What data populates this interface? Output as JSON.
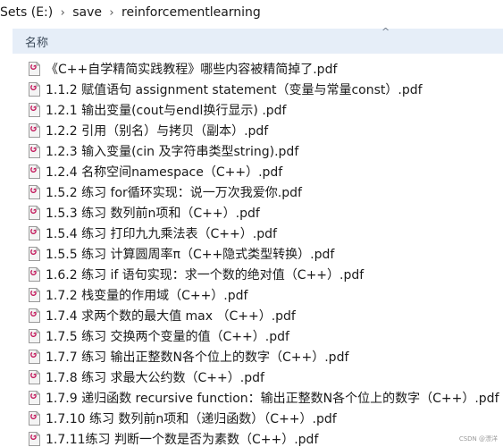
{
  "breadcrumb": {
    "items": [
      "Sets (E:)",
      "save",
      "reinforcementlearning"
    ],
    "separator": "›"
  },
  "header": {
    "name_column": "名称",
    "sort_indicator": "^"
  },
  "files": [
    "《C++自学精简实践教程》哪些内容被精简掉了.pdf",
    "1.1.2 赋值语句 assignment statement（变量与常量const）.pdf",
    "1.2.1 输出变量(cout与endl换行显示) .pdf",
    "1.2.2 引用（别名）与拷贝（副本）.pdf",
    "1.2.3 输入变量(cin 及字符串类型string).pdf",
    "1.2.4 名称空间namespace（C++）.pdf",
    "1.5.2 练习 for循环实现：说一万次我爱你.pdf",
    "1.5.3 练习 数列前n项和（C++）.pdf",
    "1.5.4 练习 打印九九乘法表（C++）.pdf",
    "1.5.5 练习 计算圆周率π（C++隐式类型转换）.pdf",
    "1.6.2 练习 if 语句实现：求一个数的绝对值（C++）.pdf",
    "1.7.2 栈变量的作用域（C++）.pdf",
    "1.7.4 求两个数的最大值 max （C++）.pdf",
    "1.7.5 练习 交换两个变量的值（C++）.pdf",
    "1.7.7 练习 输出正整数N各个位上的数字（C++）.pdf",
    "1.7.8 练习 求最大公约数（C++）.pdf",
    "1.7.9 递归函数 recursive function：输出正整数N各个位上的数字（C++）.pdf",
    "1.7.10 练习 数列前n项和（递归函数）（C++）.pdf",
    "1.7.11练习 判断一个数是否为素数（C++）.pdf"
  ],
  "icon": {
    "name": "pdf-file-icon",
    "badge_text": "PDF",
    "accent": "#c2185b",
    "paper": "#f4f4f4"
  },
  "colors": {
    "header_bg": "#e6eef8"
  },
  "watermark": "CSDN @漂洋"
}
